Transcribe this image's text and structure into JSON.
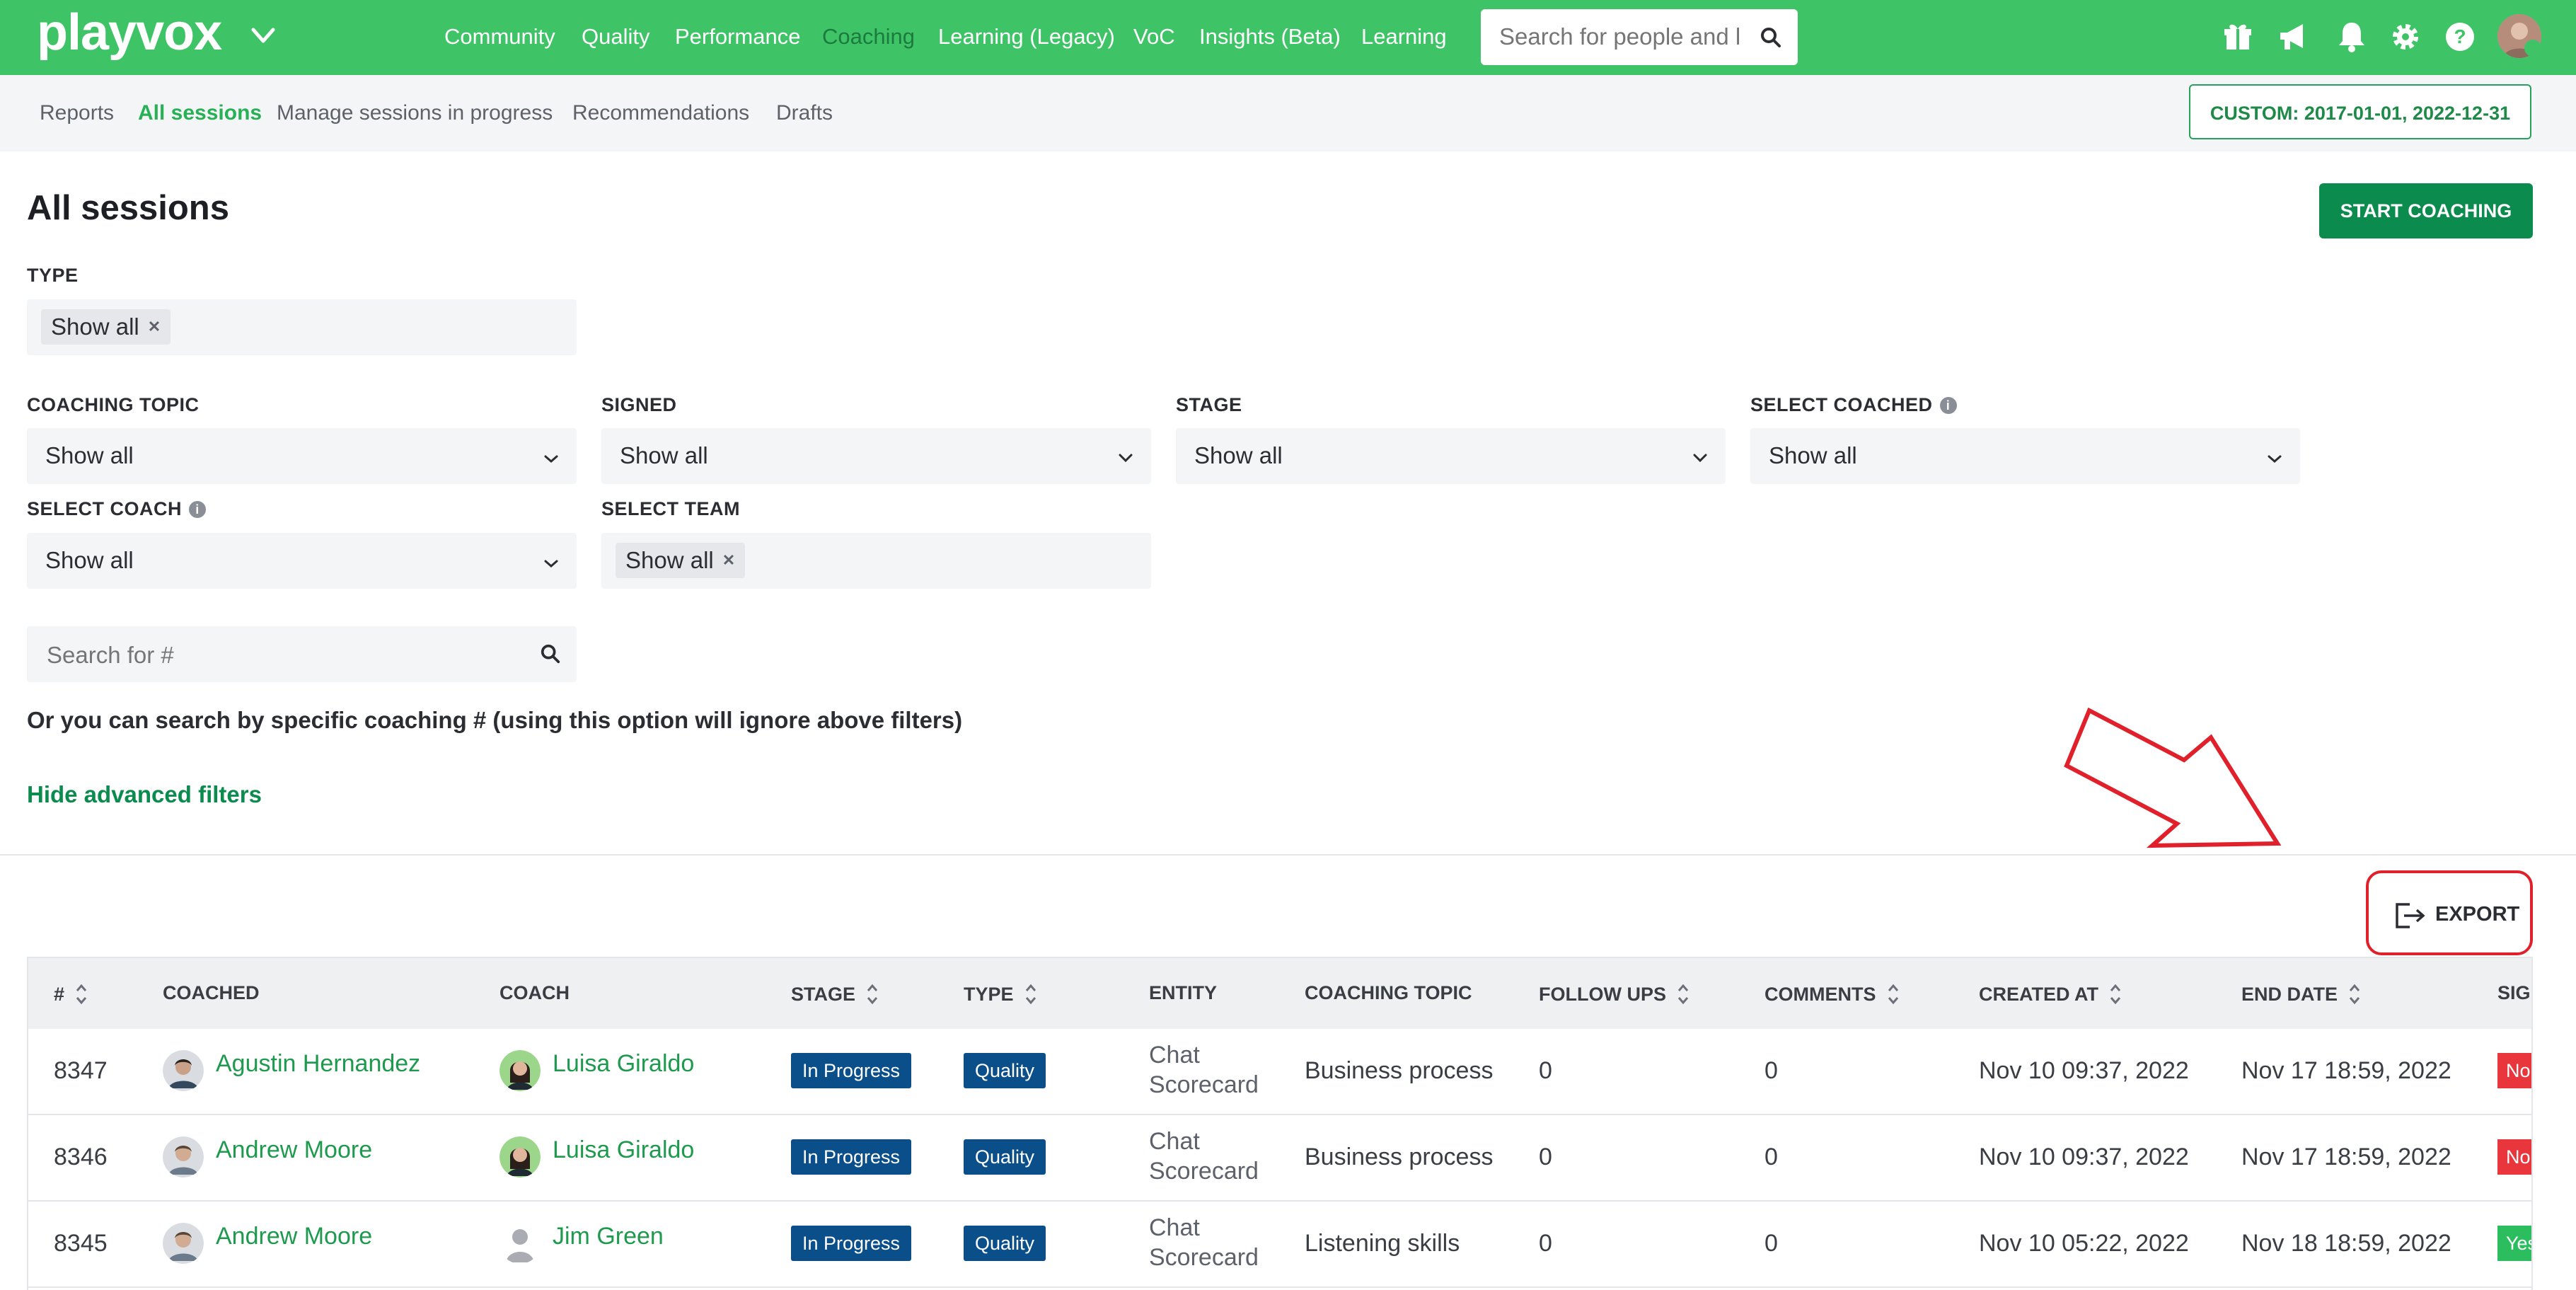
{
  "colors": {
    "nav_bg": "#3ec466",
    "brand_dark": "#0c8b4e",
    "link_green": "#1e9a4e",
    "badge_blue": "#0b4f8a",
    "signed_no": "#e8363c",
    "signed_yes": "#2bbd5e",
    "annotation_red": "#e0202a"
  },
  "topnav": {
    "logo": "playvox",
    "links": [
      "Community",
      "Quality",
      "Performance",
      "Coaching",
      "Learning (Legacy)",
      "VoC",
      "Insights (Beta)",
      "Learning"
    ],
    "active_link": "Coaching",
    "search_placeholder": "Search for people and l",
    "icons": [
      "gift-icon",
      "megaphone-icon",
      "bell-icon",
      "gear-icon",
      "help-icon",
      "user-avatar"
    ]
  },
  "subnav": {
    "links": [
      "Reports",
      "All sessions",
      "Manage sessions in progress",
      "Recommendations",
      "Drafts"
    ],
    "active_link": "All sessions",
    "date_range": "CUSTOM: 2017-01-01, 2022-12-31"
  },
  "page": {
    "title": "All sessions",
    "start_button": "START COACHING"
  },
  "filters": {
    "type": {
      "label": "TYPE",
      "chip": "Show all"
    },
    "coaching_topic": {
      "label": "COACHING TOPIC",
      "value": "Show all"
    },
    "signed": {
      "label": "SIGNED",
      "value": "Show all"
    },
    "stage": {
      "label": "STAGE",
      "value": "Show all"
    },
    "select_coached": {
      "label": "SELECT COACHED",
      "value": "Show all"
    },
    "select_coach": {
      "label": "SELECT COACH",
      "value": "Show all"
    },
    "select_team": {
      "label": "SELECT TEAM",
      "chip": "Show all"
    },
    "search_placeholder": "Search for #",
    "hint": "Or you can search by specific coaching # (using this option will ignore above filters)",
    "hide_advanced": "Hide advanced filters"
  },
  "export": {
    "label": "EXPORT"
  },
  "table": {
    "headers": [
      "#",
      "COACHED",
      "COACH",
      "STAGE",
      "TYPE",
      "ENTITY",
      "COACHING TOPIC",
      "FOLLOW UPS",
      "COMMENTS",
      "CREATED AT",
      "END DATE",
      "SIGNED"
    ],
    "rows": [
      {
        "id": "8347",
        "coached": "Agustin Hernandez",
        "coach": "Luisa Giraldo",
        "stage": "In Progress",
        "type": "Quality",
        "entity_line1": "Chat",
        "entity_line2": "Scorecard",
        "topic": "Business process",
        "follow_ups": "0",
        "comments": "0",
        "created_at": "Nov 10 09:37, 2022",
        "end_date": "Nov 17 18:59, 2022",
        "signed": "No",
        "signed_state": "no"
      },
      {
        "id": "8346",
        "coached": "Andrew Moore",
        "coach": "Luisa Giraldo",
        "stage": "In Progress",
        "type": "Quality",
        "entity_line1": "Chat",
        "entity_line2": "Scorecard",
        "topic": "Business process",
        "follow_ups": "0",
        "comments": "0",
        "created_at": "Nov 10 09:37, 2022",
        "end_date": "Nov 17 18:59, 2022",
        "signed": "No",
        "signed_state": "no"
      },
      {
        "id": "8345",
        "coached": "Andrew Moore",
        "coach": "Jim Green",
        "stage": "In Progress",
        "type": "Quality",
        "entity_line1": "Chat",
        "entity_line2": "Scorecard",
        "topic": "Listening skills",
        "follow_ups": "0",
        "comments": "0",
        "created_at": "Nov 10 05:22, 2022",
        "end_date": "Nov 18 18:59, 2022",
        "signed": "Yes",
        "signed_state": "yes"
      }
    ]
  }
}
